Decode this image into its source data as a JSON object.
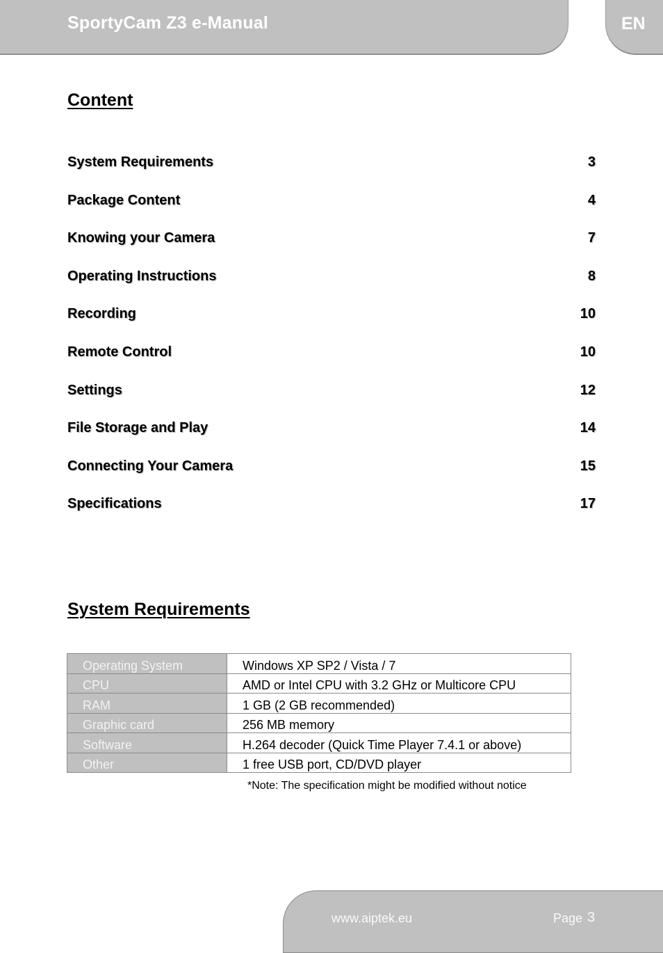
{
  "header": {
    "title": "SportyCam Z3 e-Manual",
    "language": "EN"
  },
  "content_section": {
    "title": "Content",
    "items": [
      {
        "label": "System Requirements",
        "page": "3"
      },
      {
        "label": "Package Content",
        "page": "4"
      },
      {
        "label": "Knowing your Camera",
        "page": "7"
      },
      {
        "label": "Operating Instructions",
        "page": "8"
      },
      {
        "label": "Recording",
        "page": "10"
      },
      {
        "label": "Remote Control",
        "page": "10"
      },
      {
        "label": "Settings",
        "page": "12"
      },
      {
        "label": "File Storage and Play",
        "page": "14"
      },
      {
        "label": "Connecting Your Camera",
        "page": "15"
      },
      {
        "label": "Specifications",
        "page": "17"
      }
    ]
  },
  "requirements_section": {
    "title": "System Requirements",
    "rows": [
      {
        "key": "Operating System",
        "value": "Windows XP SP2 / Vista / 7"
      },
      {
        "key": "CPU",
        "value": "AMD or Intel CPU with 3.2 GHz or Multicore CPU"
      },
      {
        "key": "RAM",
        "value": "1 GB (2 GB recommended)"
      },
      {
        "key": "Graphic card",
        "value": "256 MB memory"
      },
      {
        "key": "Software",
        "value": "H.264 decoder (Quick Time Player 7.4.1 or above)"
      },
      {
        "key": "Other",
        "value": "1 free USB port, CD/DVD player"
      }
    ],
    "note": "*Note: The specification might be modified without notice"
  },
  "footer": {
    "url": "www.aiptek.eu",
    "page_label": "Page",
    "page_number": "3"
  }
}
